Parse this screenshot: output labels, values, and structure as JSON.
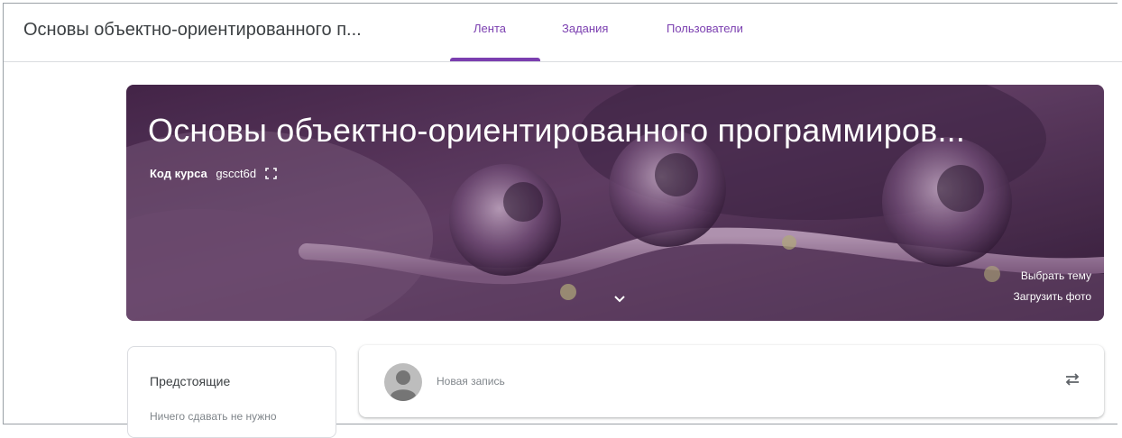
{
  "header": {
    "course_title": "Основы объектно-ориентированного п...",
    "tabs": [
      {
        "label": "Лента"
      },
      {
        "label": "Задания"
      },
      {
        "label": "Пользователи"
      }
    ]
  },
  "banner": {
    "title": "Основы объектно-ориентированного программиров...",
    "code_label": "Код курса",
    "code_value": "gscct6d",
    "select_theme": "Выбрать тему",
    "upload_photo": "Загрузить фото"
  },
  "upcoming": {
    "title": "Предстоящие",
    "text": "Ничего сдавать не нужно"
  },
  "post": {
    "placeholder": "Новая запись"
  },
  "colors": {
    "accent": "#7b3fb0",
    "banner_base": "#5a3560"
  }
}
